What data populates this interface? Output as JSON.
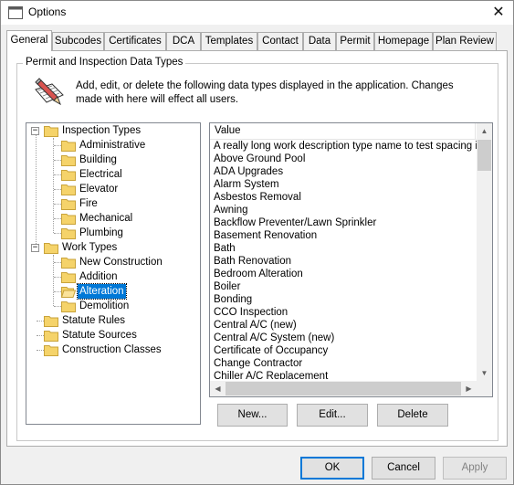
{
  "window": {
    "title": "Options",
    "close_glyph": "✕"
  },
  "tabs": [
    {
      "label": "General",
      "active": true
    },
    {
      "label": "Subcodes"
    },
    {
      "label": "Certificates"
    },
    {
      "label": "DCA"
    },
    {
      "label": "Templates"
    },
    {
      "label": "Contact"
    },
    {
      "label": "Data"
    },
    {
      "label": "Permit"
    },
    {
      "label": "Homepage"
    },
    {
      "label": "Plan Review"
    }
  ],
  "group": {
    "title": "Permit and Inspection Data Types",
    "description": "Add, edit, or delete the following data types displayed in the application.  Changes made with here will effect all users.",
    "icon": "edit-pencil-icon"
  },
  "tree": {
    "nodes": [
      {
        "label": "Inspection Types",
        "level": 0,
        "expander": "−"
      },
      {
        "label": "Administrative",
        "level": 1
      },
      {
        "label": "Building",
        "level": 1
      },
      {
        "label": "Electrical",
        "level": 1
      },
      {
        "label": "Elevator",
        "level": 1
      },
      {
        "label": "Fire",
        "level": 1
      },
      {
        "label": "Mechanical",
        "level": 1
      },
      {
        "label": "Plumbing",
        "level": 1
      },
      {
        "label": "Work Types",
        "level": 0,
        "expander": "−"
      },
      {
        "label": "New Construction",
        "level": 1
      },
      {
        "label": "Addition",
        "level": 1
      },
      {
        "label": "Alteration",
        "level": 1,
        "selected": true
      },
      {
        "label": "Demolition",
        "level": 1
      },
      {
        "label": "Statute Rules",
        "level": 0
      },
      {
        "label": "Statute Sources",
        "level": 0
      },
      {
        "label": "Construction Classes",
        "level": 0
      }
    ]
  },
  "list": {
    "column_header": "Value",
    "rows": [
      "A really long work description type name to test spacing iss...",
      "Above Ground Pool",
      "ADA Upgrades",
      "Alarm System",
      "Asbestos Removal",
      "Awning",
      "Backflow Preventer/Lawn Sprinkler",
      "Basement Renovation",
      "Bath",
      "Bath Renovation",
      "Bedroom Alteration",
      "Boiler",
      "Bonding",
      "CCO Inspection",
      "Central A/C (new)",
      "Central A/C System (new)",
      "Certificate of Occupancy",
      "Change Contractor",
      "Chiller A/C Replacement"
    ]
  },
  "buttons": {
    "new": "New...",
    "edit": "Edit...",
    "delete": "Delete",
    "ok": "OK",
    "cancel": "Cancel",
    "apply": "Apply"
  },
  "colors": {
    "selection": "#0078d7",
    "folder": "#f5d36a"
  }
}
